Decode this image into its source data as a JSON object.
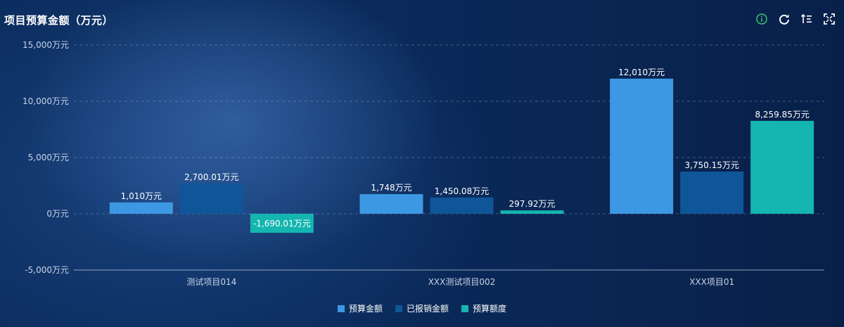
{
  "title": "项目预算金额（万元）",
  "toolbar": {
    "icons": [
      "info-icon",
      "refresh-icon",
      "sort-icon",
      "fullscreen-icon"
    ]
  },
  "chart_data": {
    "type": "bar",
    "title": "项目预算金额（万元）",
    "categories": [
      "测试项目014",
      "XXX测试项目002",
      "XXX项目01"
    ],
    "series": [
      {
        "name": "预算金额",
        "color": "#3d98e3",
        "values": [
          1010,
          1748,
          12010
        ],
        "labels": [
          "1,010万元",
          "1,748万元",
          "12,010万元"
        ]
      },
      {
        "name": "已报销金额",
        "color": "#0f5698",
        "values": [
          2700.01,
          1450.08,
          3750.15
        ],
        "labels": [
          "2,700.01万元",
          "1,450.08万元",
          "3,750.15万元"
        ]
      },
      {
        "name": "预算额度",
        "color": "#15b5b0",
        "values": [
          -1690.01,
          297.92,
          8259.85
        ],
        "labels": [
          "-1,690.01万元",
          "297.92万元",
          "8,259.85万元"
        ]
      }
    ],
    "yticks": [
      15000,
      10000,
      5000,
      0,
      -5000
    ],
    "ytick_labels": [
      "15,000万元",
      "10,000万元",
      "5,000万元",
      "0万元",
      "-5,000万元"
    ],
    "ylim": [
      -5000,
      15000
    ],
    "grid": true,
    "legend": "bottom-center"
  }
}
